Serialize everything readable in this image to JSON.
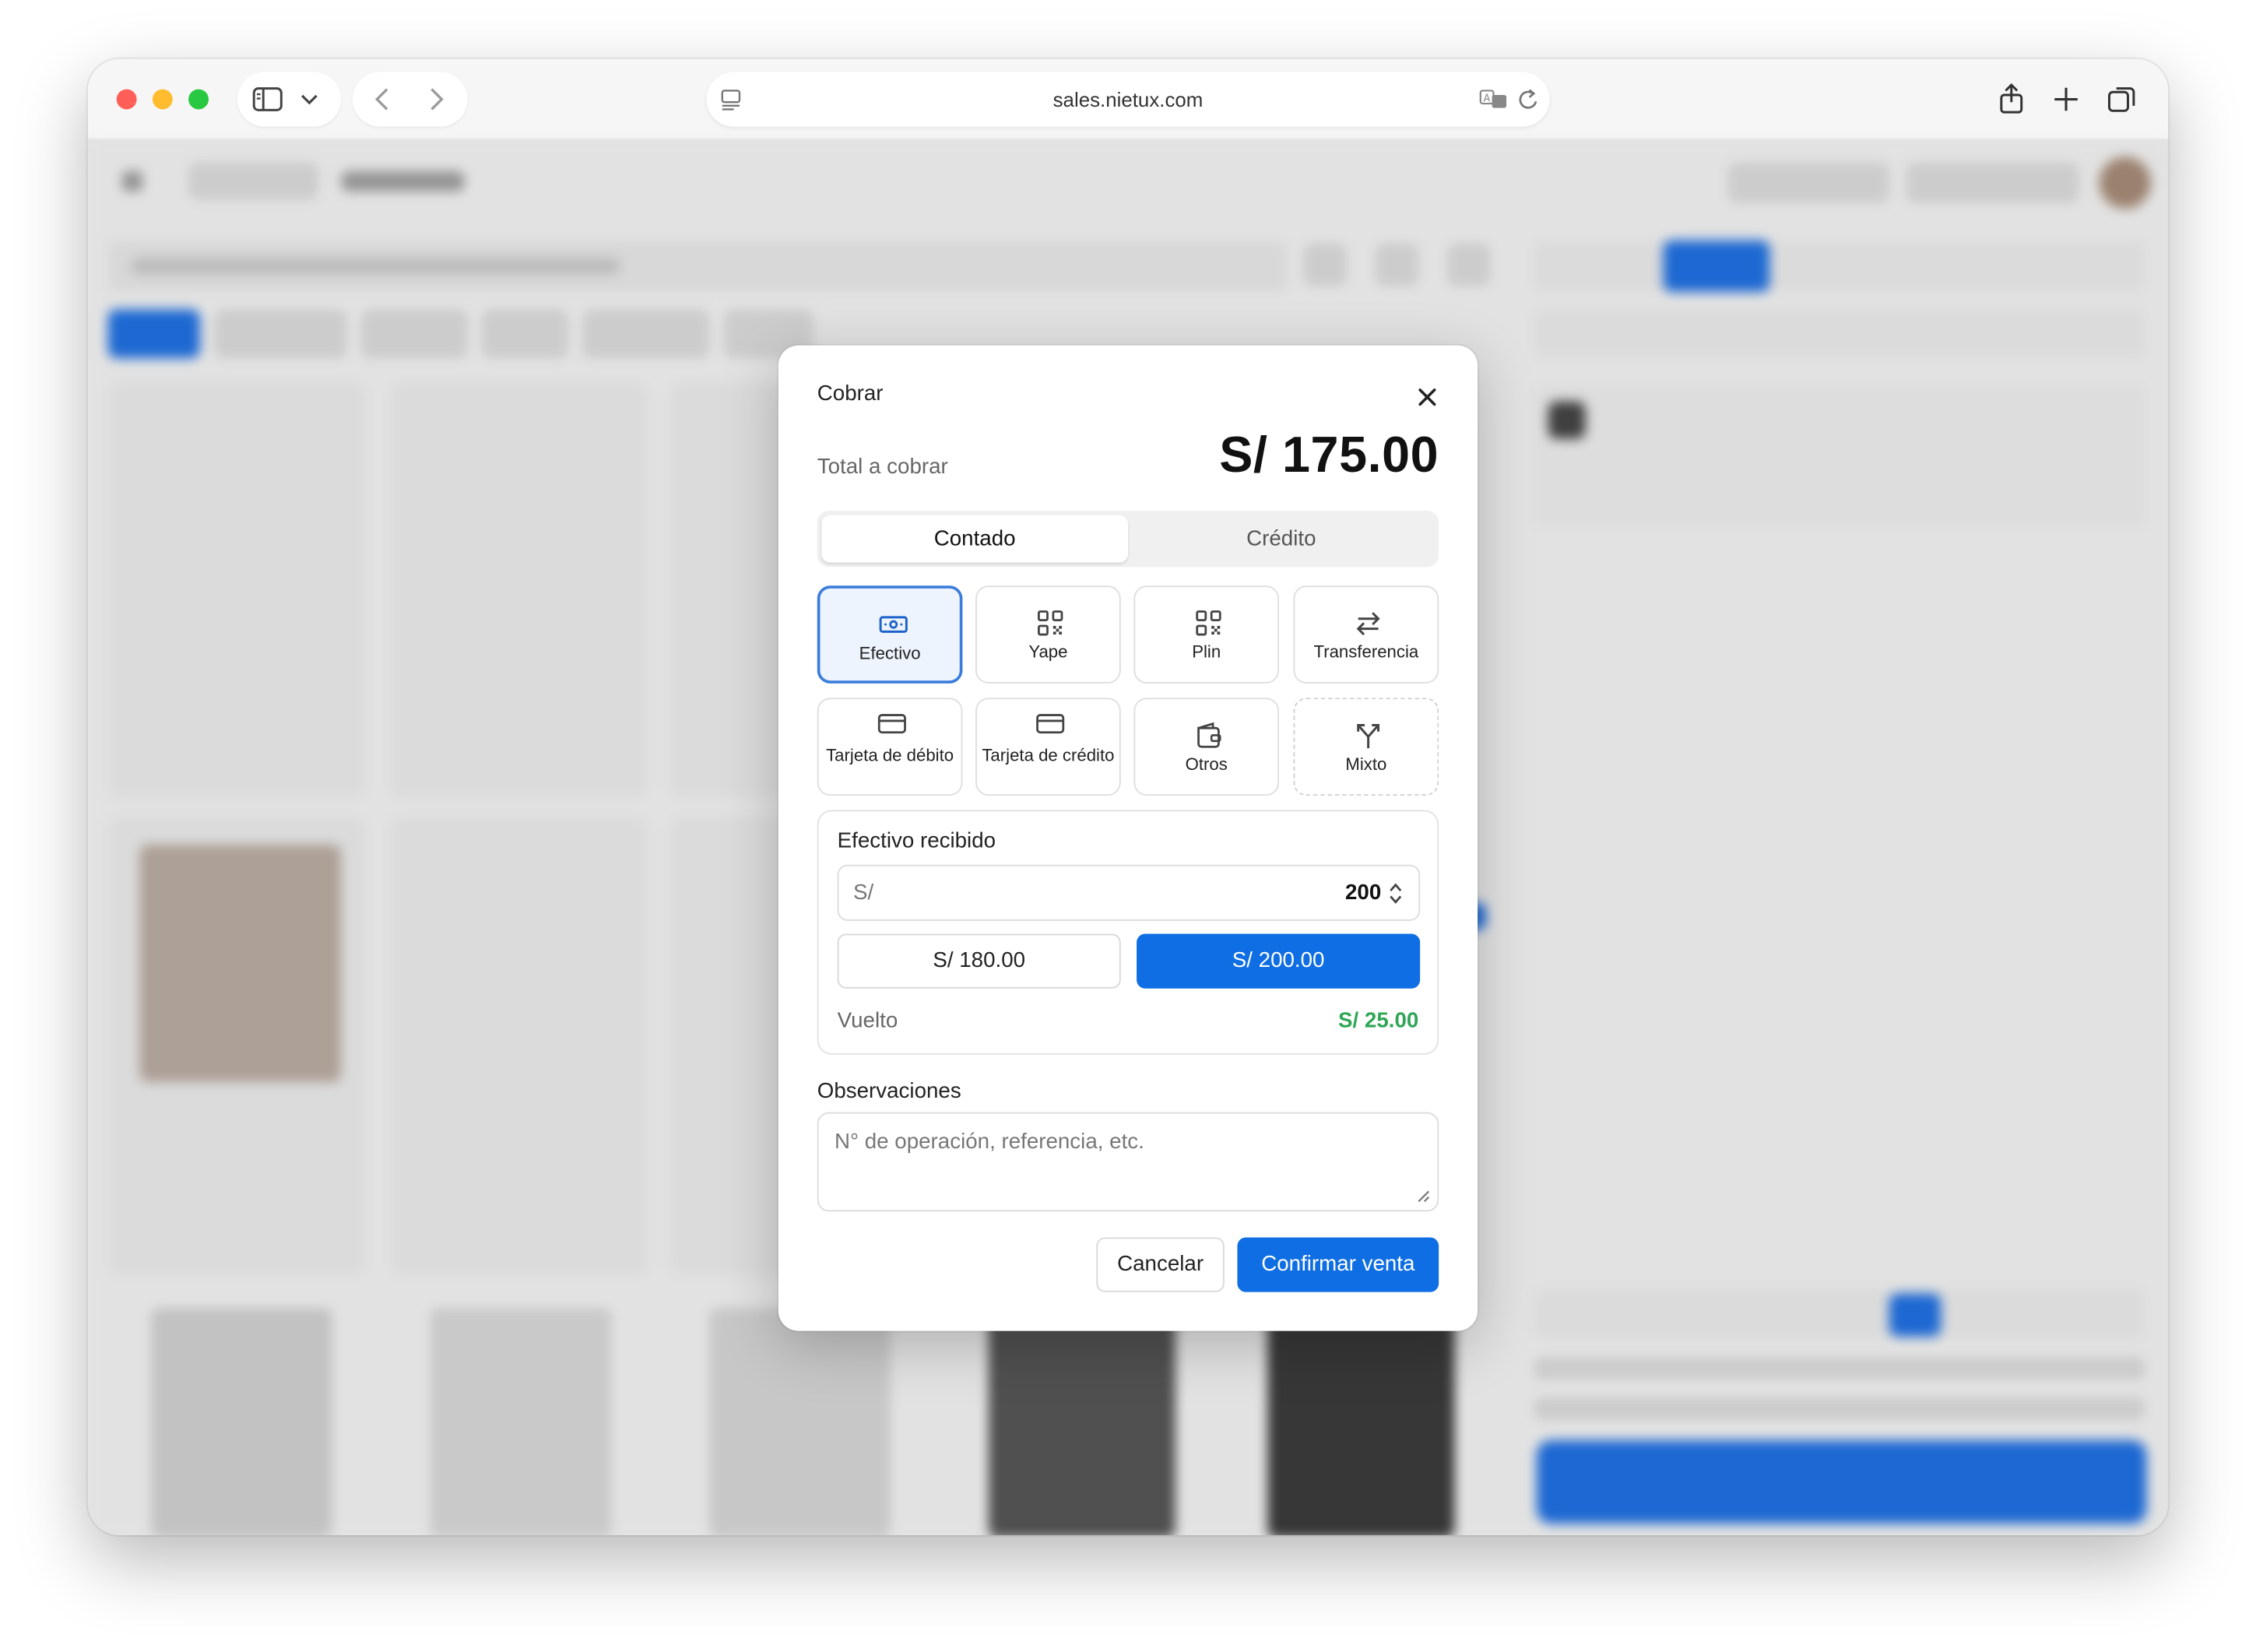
{
  "browser": {
    "url": "sales.nietux.com"
  },
  "modal": {
    "title": "Cobrar",
    "total_label": "Total a cobrar",
    "total_value": "S/ 175.00",
    "payment_terms": [
      {
        "label": "Contado",
        "selected": true
      },
      {
        "label": "Crédito",
        "selected": false
      }
    ],
    "methods": [
      {
        "label": "Efectivo",
        "icon": "cash-icon",
        "selected": true
      },
      {
        "label": "Yape",
        "icon": "qr-code-icon",
        "selected": false
      },
      {
        "label": "Plin",
        "icon": "qr-code-icon",
        "selected": false
      },
      {
        "label": "Transferencia",
        "icon": "transfer-arrows-icon",
        "selected": false
      },
      {
        "label": "Tarjeta de débito",
        "icon": "credit-card-icon",
        "selected": false
      },
      {
        "label": "Tarjeta de crédito",
        "icon": "credit-card-icon",
        "selected": false
      },
      {
        "label": "Otros",
        "icon": "wallet-icon",
        "selected": false
      },
      {
        "label": "Mixto",
        "icon": "split-arrows-icon",
        "selected": false
      }
    ],
    "cash": {
      "title": "Efectivo recibido",
      "currency_prefix": "S/",
      "received_value": "200",
      "quick_amounts": [
        "S/ 180.00",
        "S/ 200.00"
      ],
      "selected_quick_amount": "S/ 200.00",
      "change_label": "Vuelto",
      "change_value": "S/ 25.00"
    },
    "notes": {
      "label": "Observaciones",
      "placeholder": "N° de operación, referencia, etc.",
      "value": ""
    },
    "actions": {
      "cancel_label": "Cancelar",
      "confirm_label": "Confirmar venta"
    }
  },
  "colors": {
    "primary": "#0f6ee3",
    "selected_border": "#3b7ddb",
    "change_green": "#2fa656"
  }
}
